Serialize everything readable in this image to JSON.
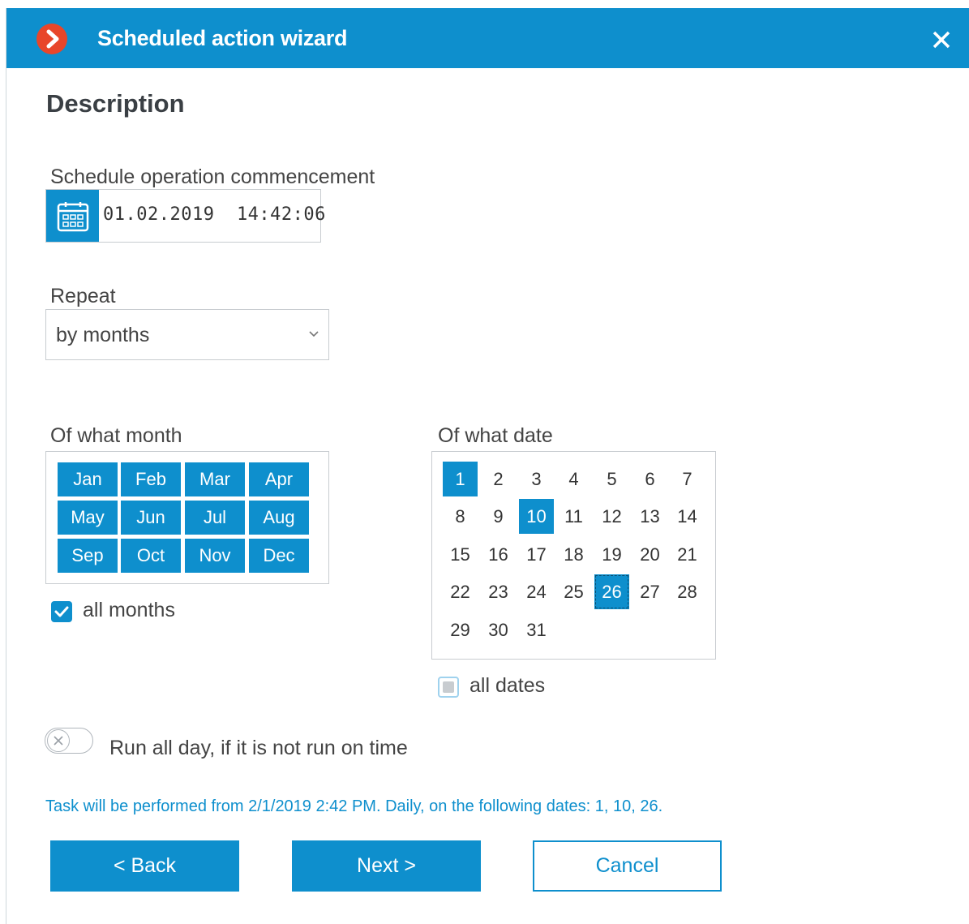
{
  "window": {
    "title": "Scheduled action wizard"
  },
  "section": {
    "title": "Description"
  },
  "commencement": {
    "label": "Schedule operation commencement",
    "value": "01.02.2019  14:42:06"
  },
  "repeat": {
    "label": "Repeat",
    "value": "by months"
  },
  "months": {
    "label": "Of what month",
    "items": [
      "Jan",
      "Feb",
      "Mar",
      "Apr",
      "May",
      "Jun",
      "Jul",
      "Aug",
      "Sep",
      "Oct",
      "Nov",
      "Dec"
    ],
    "all_label": "all months",
    "all_checked": true
  },
  "dates": {
    "label": "Of what date",
    "items": [
      "1",
      "2",
      "3",
      "4",
      "5",
      "6",
      "7",
      "8",
      "9",
      "10",
      "11",
      "12",
      "13",
      "14",
      "15",
      "16",
      "17",
      "18",
      "19",
      "20",
      "21",
      "22",
      "23",
      "24",
      "25",
      "26",
      "27",
      "28",
      "29",
      "30",
      "31"
    ],
    "selected": [
      "1",
      "10",
      "26"
    ],
    "all_label": "all dates",
    "all_checked": false
  },
  "run_all_day": {
    "label": "Run all day, if it is not run on time",
    "on": false
  },
  "summary": "Task will be performed from 2/1/2019 2:42 PM. Daily, on the following dates: 1, 10, 26.",
  "buttons": {
    "back": "< Back",
    "next": "Next >",
    "cancel": "Cancel"
  },
  "colors": {
    "accent": "#0e8fcd",
    "logo": "#e8462a"
  }
}
